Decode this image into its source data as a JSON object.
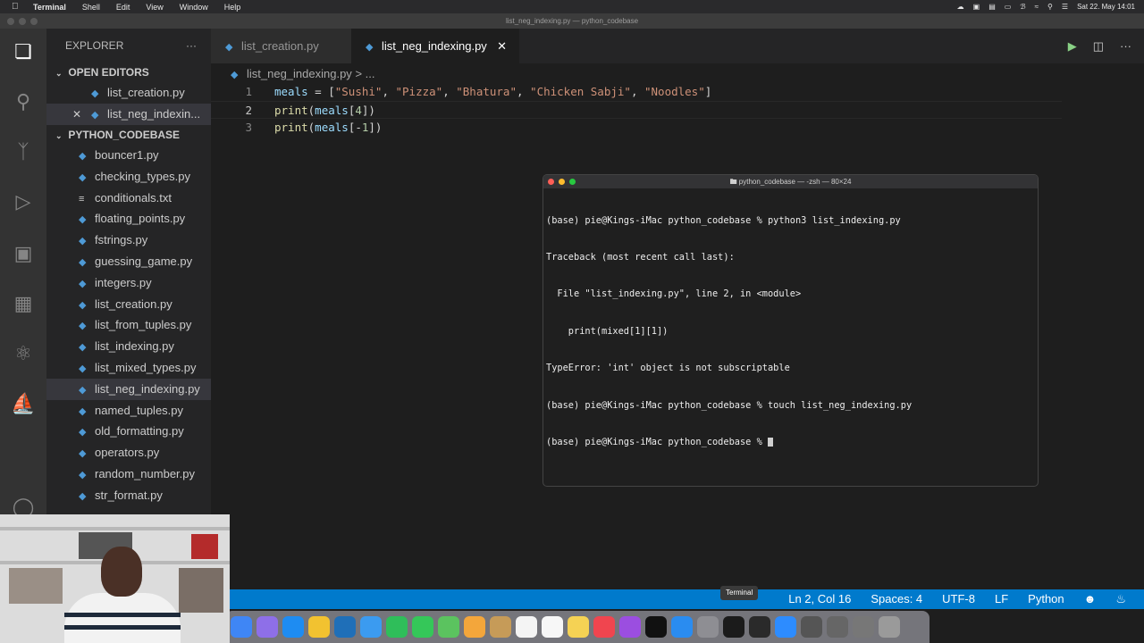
{
  "menubar": {
    "app": "Terminal",
    "items": [
      "Shell",
      "Edit",
      "View",
      "Window",
      "Help"
    ],
    "clock": "Sat 22. May 14:01"
  },
  "window_title": "list_neg_indexing.py — python_codebase",
  "explorer": {
    "header": "EXPLORER",
    "more_icon": "ellipsis-icon",
    "open_editors_label": "OPEN EDITORS",
    "open_editors": [
      "list_creation.py",
      "list_neg_indexin..."
    ],
    "folder_label": "PYTHON_CODEBASE",
    "files": [
      {
        "name": "bouncer1.py",
        "icon": "python-icon"
      },
      {
        "name": "checking_types.py",
        "icon": "python-icon"
      },
      {
        "name": "conditionals.txt",
        "icon": "text-file-icon"
      },
      {
        "name": "floating_points.py",
        "icon": "python-icon"
      },
      {
        "name": "fstrings.py",
        "icon": "python-icon"
      },
      {
        "name": "guessing_game.py",
        "icon": "python-icon"
      },
      {
        "name": "integers.py",
        "icon": "python-icon"
      },
      {
        "name": "list_creation.py",
        "icon": "python-icon"
      },
      {
        "name": "list_from_tuples.py",
        "icon": "python-icon"
      },
      {
        "name": "list_indexing.py",
        "icon": "python-icon"
      },
      {
        "name": "list_mixed_types.py",
        "icon": "python-icon"
      },
      {
        "name": "list_neg_indexing.py",
        "icon": "python-icon"
      },
      {
        "name": "named_tuples.py",
        "icon": "python-icon"
      },
      {
        "name": "old_formatting.py",
        "icon": "python-icon"
      },
      {
        "name": "operators.py",
        "icon": "python-icon"
      },
      {
        "name": "random_number.py",
        "icon": "python-icon"
      },
      {
        "name": "str_format.py",
        "icon": "python-icon"
      }
    ]
  },
  "tabs": [
    {
      "label": "list_creation.py",
      "active": false
    },
    {
      "label": "list_neg_indexing.py",
      "active": true
    }
  ],
  "breadcrumb": {
    "file": "list_neg_indexing.py",
    "sep": "> ..."
  },
  "editor": {
    "lines": [
      {
        "num": "1",
        "code": "meals = [\"Sushi\", \"Pizza\", \"Bhatura\", \"Chicken Sabji\", \"Noodles\"]"
      },
      {
        "num": "2",
        "code": "print(meals[4])"
      },
      {
        "num": "3",
        "code": "print(meals[-1])"
      }
    ]
  },
  "terminal": {
    "title": "python_codebase — -zsh — 80×24",
    "lines": [
      "(base) pie@Kings-iMac python_codebase % python3 list_indexing.py",
      "Traceback (most recent call last):",
      "  File \"list_indexing.py\", line 2, in <module>",
      "    print(mixed[1][1])",
      "TypeError: 'int' object is not subscriptable",
      "(base) pie@Kings-iMac python_codebase % touch list_neg_indexing.py",
      "(base) pie@Kings-iMac python_codebase % "
    ]
  },
  "statusbar": {
    "position": "Ln 2, Col 16",
    "spaces": "Spaces: 4",
    "encoding": "UTF-8",
    "eol": "LF",
    "language": "Python"
  },
  "dock_tooltip": "Terminal",
  "colors": {
    "accent": "#007acc",
    "editor_bg": "#1e1e1e",
    "sidebar_bg": "#252526",
    "string": "#ce9178",
    "function": "#dcdcaa",
    "variable": "#9cdcfe",
    "number": "#b5cea8"
  }
}
